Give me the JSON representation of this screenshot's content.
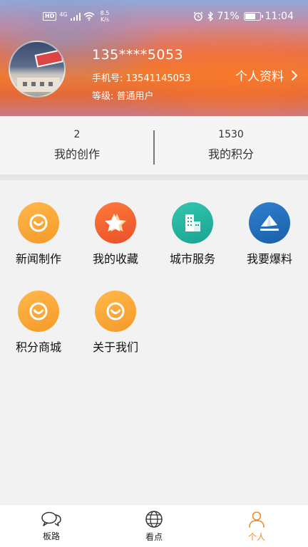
{
  "status_bar": {
    "left_hd": "HD",
    "left_network": "4G",
    "left_speed_value": "8.5",
    "left_speed_unit": "K/s",
    "battery_percent": "71%",
    "time": "11:04"
  },
  "profile": {
    "username": "135****5053",
    "phone": "手机号: 13541145053",
    "level": "等级: 普通用户",
    "profile_link": "个人资料"
  },
  "stats": [
    {
      "value": "2",
      "label": "我的创作"
    },
    {
      "value": "1530",
      "label": "我的积分"
    }
  ],
  "features": [
    {
      "label": "新闻制作",
      "icon": "smile-icon",
      "color": "#f59a2a"
    },
    {
      "label": "我的收藏",
      "icon": "star-icon",
      "color": "#e8502a"
    },
    {
      "label": "城市服务",
      "icon": "building-icon",
      "color": "#1aa392"
    },
    {
      "label": "我要爆料",
      "icon": "paper-plane-icon",
      "color": "#1a5fa8"
    },
    {
      "label": "积分商城",
      "icon": "smile-icon",
      "color": "#f59a2a"
    },
    {
      "label": "关于我们",
      "icon": "smile-icon",
      "color": "#f59a2a"
    }
  ],
  "tabbar": [
    {
      "label": "板路",
      "icon": "chat-bubbles-icon",
      "active": false
    },
    {
      "label": "看点",
      "icon": "globe-icon",
      "active": false
    },
    {
      "label": "个人",
      "icon": "person-icon",
      "active": true
    }
  ],
  "colors": {
    "accent": "#f08a2c"
  }
}
